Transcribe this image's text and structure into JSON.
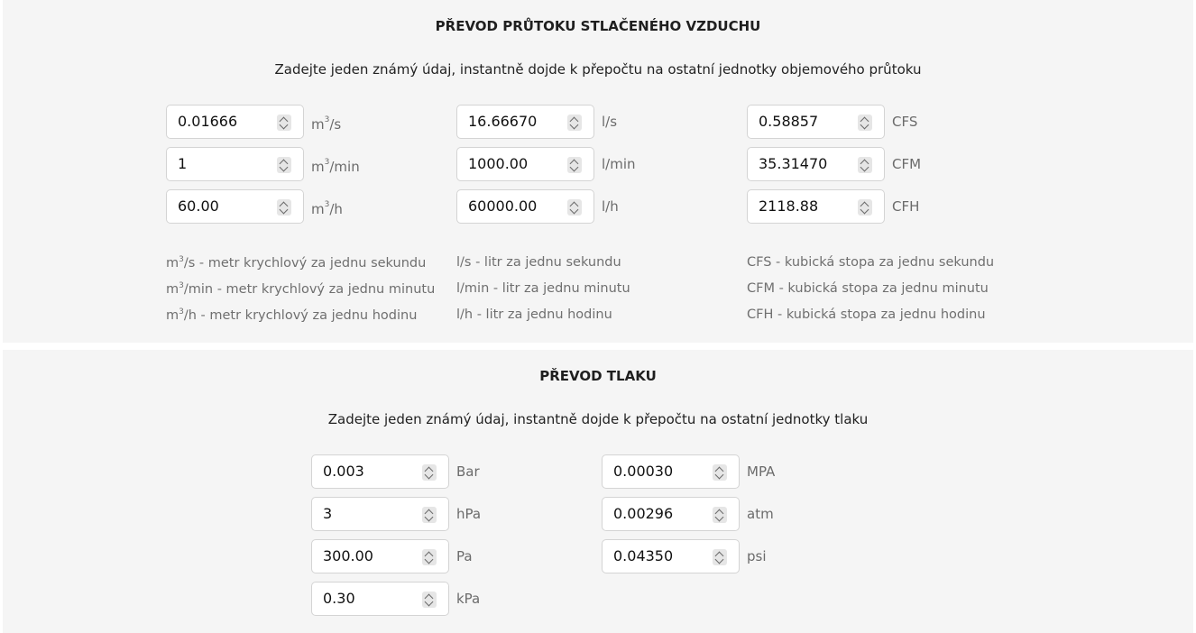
{
  "flow": {
    "title": "PŘEVOD PRŮTOKU STLAČENÉHO VZDUCHU",
    "subtitle": "Zadejte jeden známý údaj, instantně dojde k přepočtu na ostatní jednotky objemového průtoku",
    "fields": {
      "m3s": {
        "value": "0.01666",
        "unit_base": "m",
        "unit_sup": "3",
        "unit_rest": "/s"
      },
      "m3min": {
        "value": "1",
        "unit_base": "m",
        "unit_sup": "3",
        "unit_rest": "/min"
      },
      "m3h": {
        "value": "60.00",
        "unit_base": "m",
        "unit_sup": "3",
        "unit_rest": "/h"
      },
      "ls": {
        "value": "16.66670",
        "unit": "l/s"
      },
      "lmin": {
        "value": "1000.00",
        "unit": "l/min"
      },
      "lh": {
        "value": "60000.00",
        "unit": "l/h"
      },
      "cfs": {
        "value": "0.58857",
        "unit": "CFS"
      },
      "cfm": {
        "value": "35.31470",
        "unit": "CFM"
      },
      "cfh": {
        "value": "2118.88",
        "unit": "CFH"
      }
    },
    "legend": {
      "m3s": {
        "base": "m",
        "sup": "3",
        "rest": "/s - metr krychlový za jednu sekundu"
      },
      "m3min": {
        "base": "m",
        "sup": "3",
        "rest": "/min - metr krychlový za jednu minutu"
      },
      "m3h": {
        "base": "m",
        "sup": "3",
        "rest": "/h - metr krychlový za jednu hodinu"
      },
      "ls": "l/s - litr za jednu sekundu",
      "lmin": "l/min - litr za jednu minutu",
      "lh": "l/h - litr za jednu hodinu",
      "cfs": "CFS - kubická stopa za jednu sekundu",
      "cfm": "CFM - kubická stopa za jednu minutu",
      "cfh": "CFH - kubická stopa za jednu hodinu"
    }
  },
  "pressure": {
    "title": "PŘEVOD TLAKU",
    "subtitle": "Zadejte jeden známý údaj, instantně dojde k přepočtu na ostatní jednotky tlaku",
    "fields": {
      "bar": {
        "value": "0.003",
        "unit": "Bar"
      },
      "hpa": {
        "value": "3",
        "unit": "hPa"
      },
      "pa": {
        "value": "300.00",
        "unit": "Pa"
      },
      "kpa": {
        "value": "0.30",
        "unit": "kPa"
      },
      "mpa": {
        "value": "0.00030",
        "unit": "MPA"
      },
      "atm": {
        "value": "0.00296",
        "unit": "atm"
      },
      "psi": {
        "value": "0.04350",
        "unit": "psi"
      }
    }
  }
}
